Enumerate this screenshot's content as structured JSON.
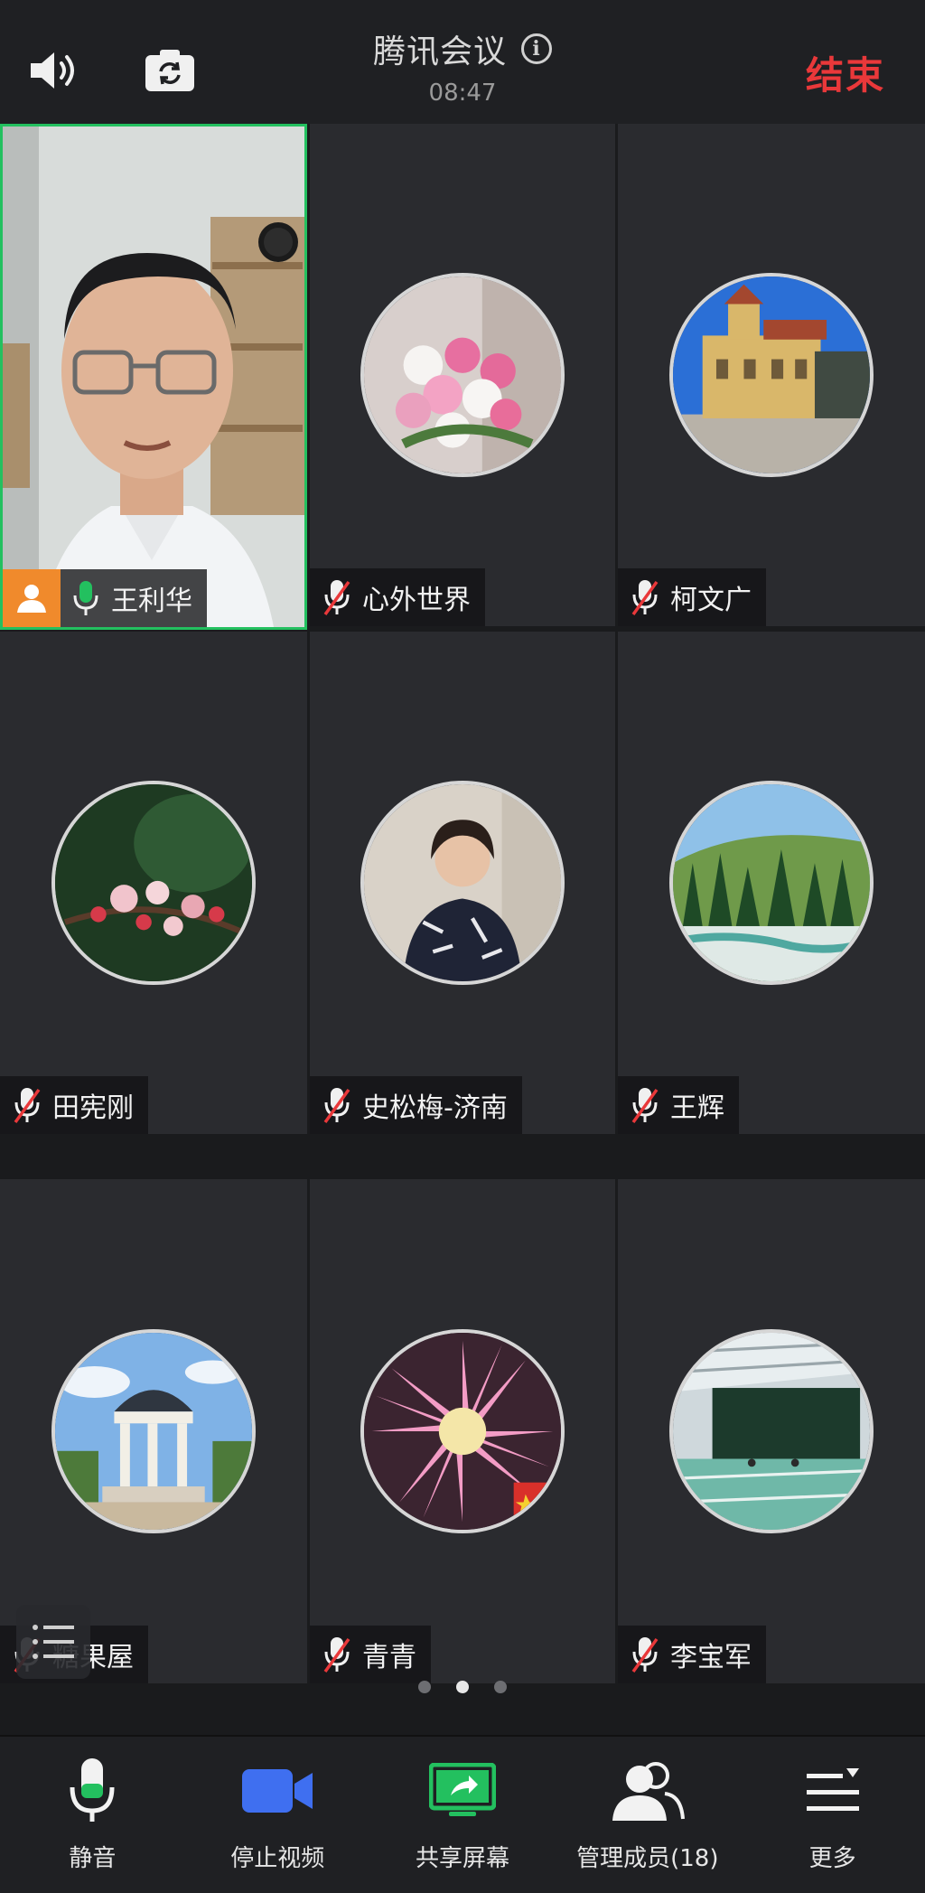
{
  "app": {
    "title": "腾讯会议",
    "time": "08:47",
    "end_label": "结束"
  },
  "participants": [
    {
      "name": "王利华",
      "muted": false,
      "host": true,
      "video": true
    },
    {
      "name": "心外世界",
      "muted": true
    },
    {
      "name": "柯文广",
      "muted": true
    },
    {
      "name": "田宪刚",
      "muted": true
    },
    {
      "name": "史松梅-济南",
      "muted": true
    },
    {
      "name": "王辉",
      "muted": true
    },
    {
      "name": "糖果屋",
      "muted": true
    },
    {
      "name": "青青",
      "muted": true
    },
    {
      "name": "李宝军",
      "muted": true
    }
  ],
  "pagination": {
    "pages": 3,
    "current": 2
  },
  "toolbar": {
    "mute_label": "静音",
    "video_label": "停止视频",
    "share_label": "共享屏幕",
    "members_label": "管理成员(18)",
    "more_label": "更多"
  },
  "colors": {
    "end": "#e9383a",
    "active_border": "#23c05f",
    "host_badge": "#f08a2c",
    "mic_on": "#23c05f",
    "video_icon": "#3f6ff0",
    "share_icon": "#23c05f"
  }
}
